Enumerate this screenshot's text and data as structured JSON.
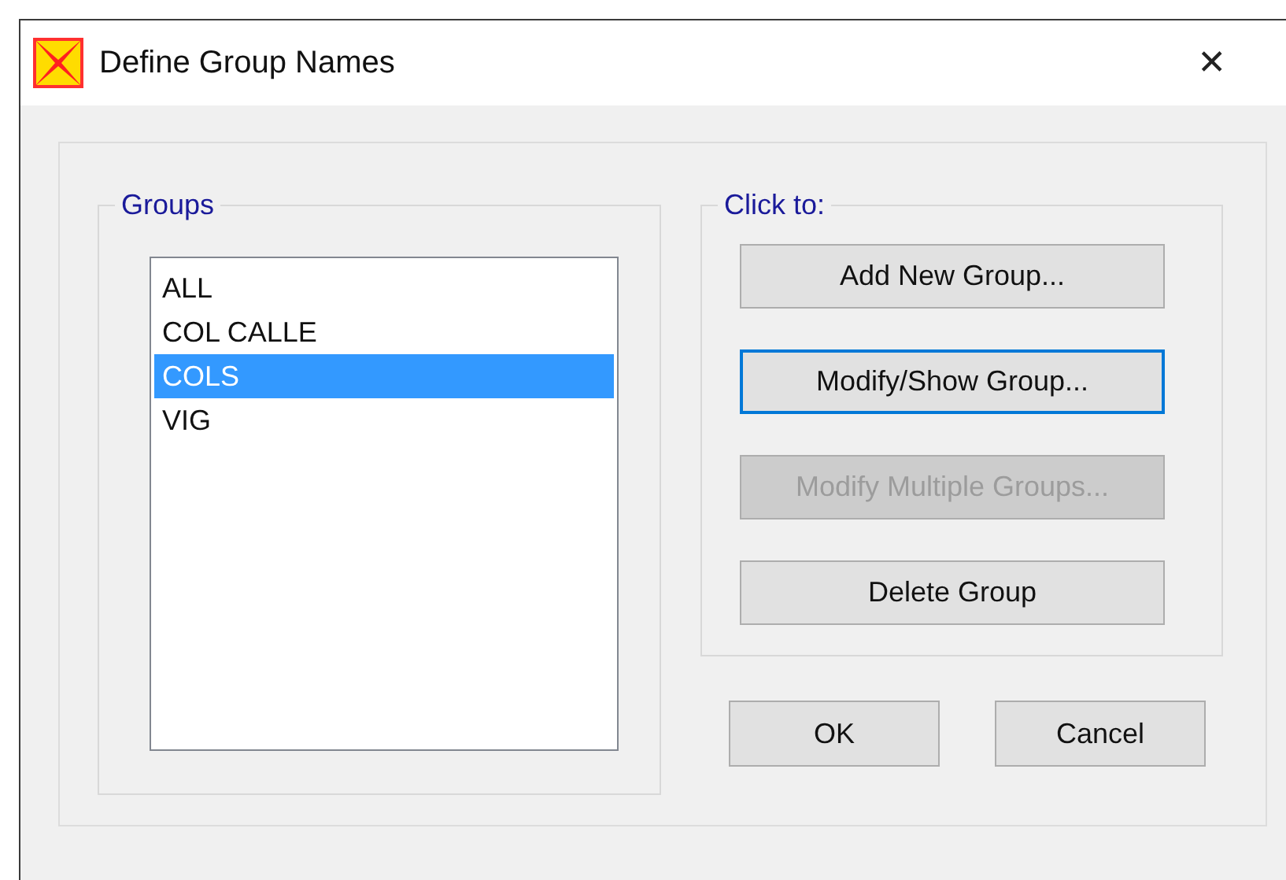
{
  "window": {
    "title": "Define Group Names",
    "close": "✕"
  },
  "groups": {
    "legend": "Groups",
    "items": [
      {
        "label": "ALL",
        "selected": false
      },
      {
        "label": "COL CALLE",
        "selected": false
      },
      {
        "label": "COLS",
        "selected": true
      },
      {
        "label": "VIG",
        "selected": false
      }
    ]
  },
  "click_to": {
    "legend": "Click to:",
    "buttons": [
      {
        "label": "Add New Group...",
        "focused": false,
        "disabled": false
      },
      {
        "label": "Modify/Show Group...",
        "focused": true,
        "disabled": false
      },
      {
        "label": "Modify Multiple Groups...",
        "focused": false,
        "disabled": true
      },
      {
        "label": "Delete Group",
        "focused": false,
        "disabled": false
      }
    ]
  },
  "buttons": [
    "OK",
    "Cancel"
  ]
}
